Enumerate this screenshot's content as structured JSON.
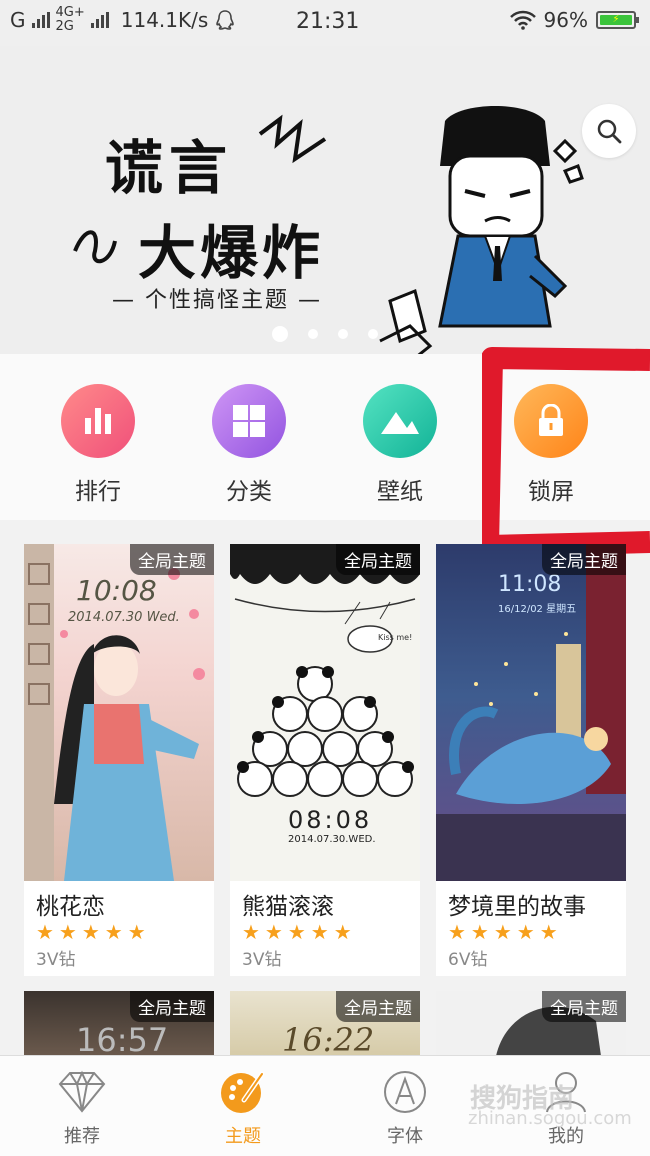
{
  "status_bar": {
    "carrier1": "G",
    "carrier2_top": "4G+",
    "carrier2_bottom": "2G",
    "speed": "114.1K/s",
    "time": "21:31",
    "battery": "96%"
  },
  "banner": {
    "title_line1": "谎言",
    "title_line2": "大爆炸",
    "subtitle": "— 个性搞怪主题 —",
    "page_count": 4,
    "active_page": 0
  },
  "categories": [
    {
      "label": "排行",
      "icon": "bar-chart-icon",
      "color_from": "#ff7f7f",
      "color_to": "#f2557a"
    },
    {
      "label": "分类",
      "icon": "grid-icon",
      "color_from": "#c68bf2",
      "color_to": "#9a5ce2"
    },
    {
      "label": "壁纸",
      "icon": "mountain-icon",
      "color_from": "#4fe0bf",
      "color_to": "#18b79a"
    },
    {
      "label": "锁屏",
      "icon": "lock-icon",
      "color_from": "#ffb24f",
      "color_to": "#ff8a1c"
    }
  ],
  "themes": [
    {
      "tag": "全局主题",
      "name": "桃花恋",
      "stars": "★★★★★",
      "price": "3V钻",
      "clock": "10:08",
      "date": "2014.07.30 Wed."
    },
    {
      "tag": "全局主题",
      "name": "熊猫滚滚",
      "stars": "★★★★★",
      "price": "3V钻",
      "clock": "08:08",
      "date": "2014.07.30.WED."
    },
    {
      "tag": "全局主题",
      "name": "梦境里的故事",
      "stars": "★★★★★",
      "price": "6V钻",
      "clock": "11:08",
      "date": "16/12/02 星期五"
    }
  ],
  "themes_row2": [
    {
      "tag": "全局主题",
      "clock": "16:57"
    },
    {
      "tag": "全局主题",
      "clock": "16:22"
    },
    {
      "tag": "全局主题",
      "clock": ""
    }
  ],
  "tabs": [
    {
      "label": "推荐",
      "icon": "diamond-icon"
    },
    {
      "label": "主题",
      "icon": "palette-icon",
      "active": true
    },
    {
      "label": "字体",
      "icon": "font-a-icon"
    },
    {
      "label": "我的",
      "icon": "person-icon"
    }
  ],
  "watermark": {
    "line1": "搜狗指南",
    "line2": "zhinan.sogou.com"
  },
  "colors": {
    "accent": "#f39a1c",
    "star": "#f7a01c",
    "highlight_stroke": "#e0192b"
  }
}
